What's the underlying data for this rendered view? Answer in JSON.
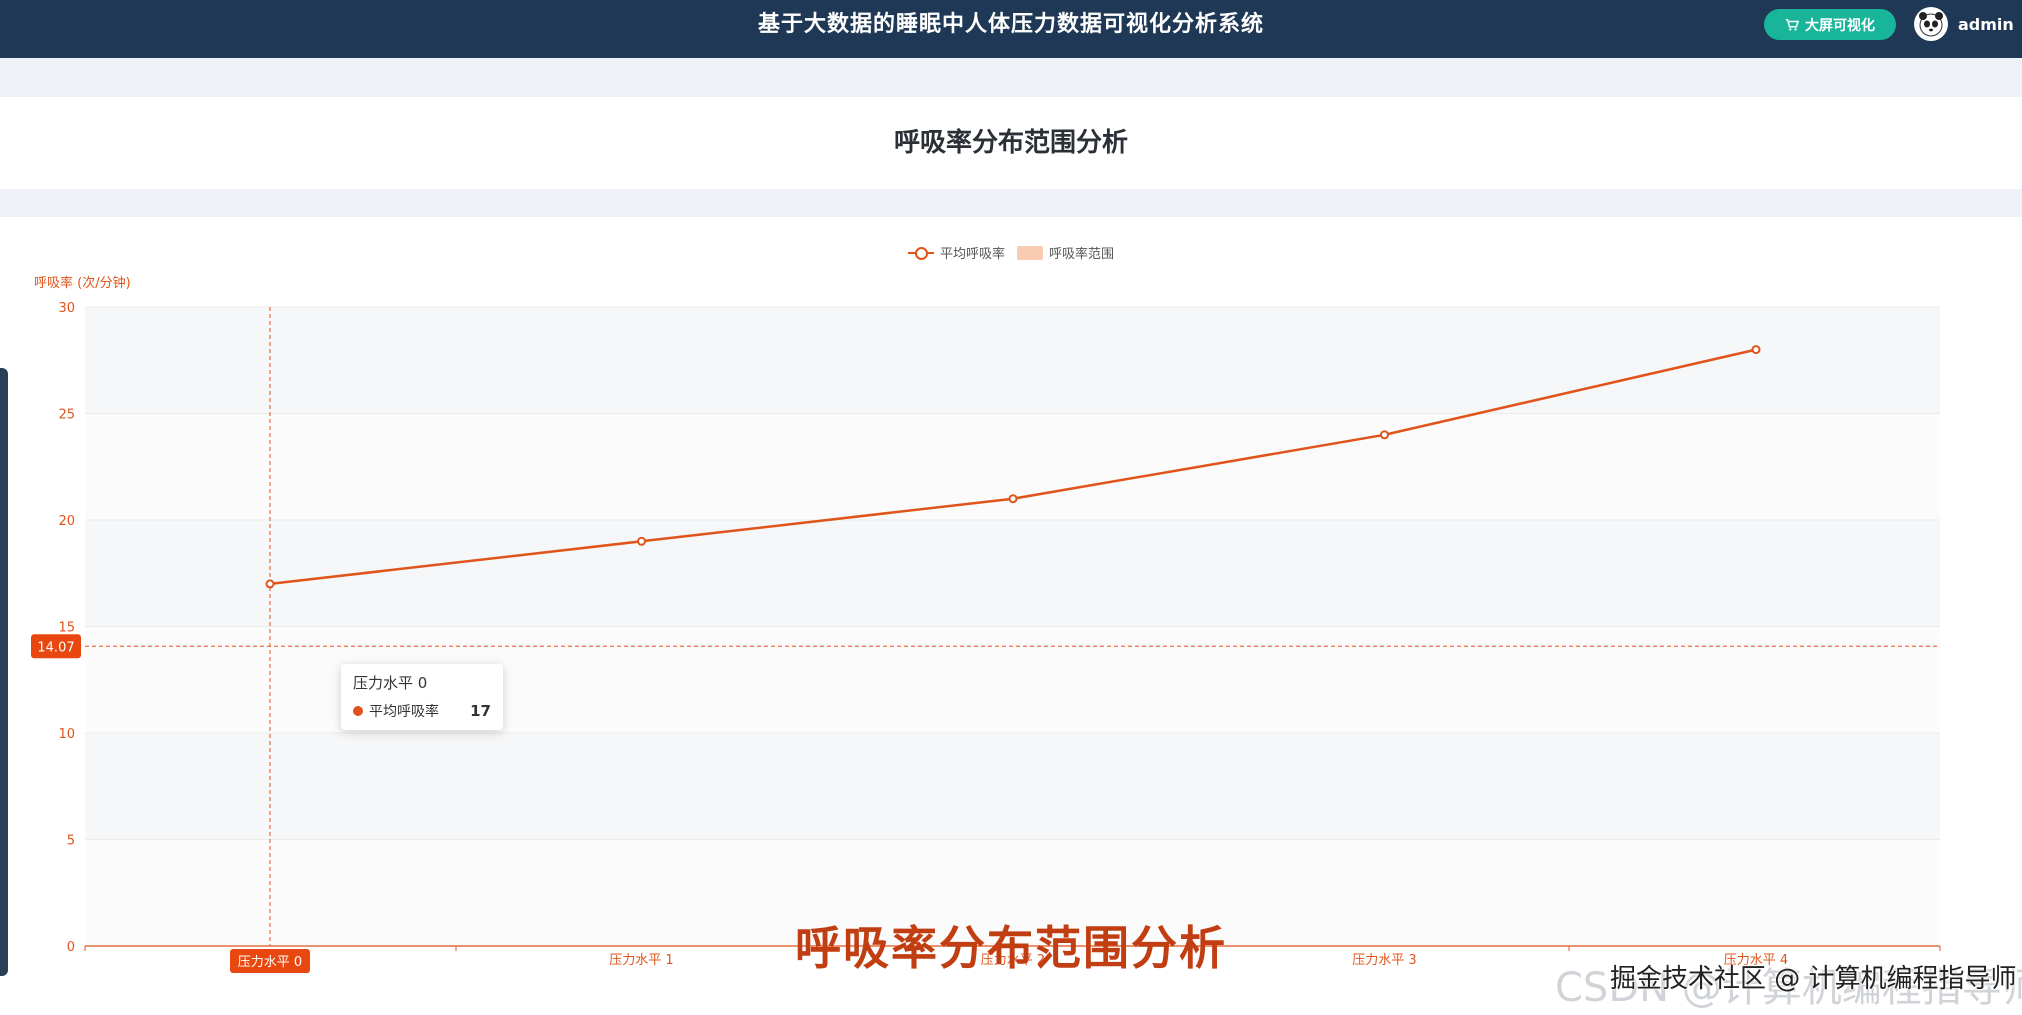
{
  "header": {
    "app_title": "基于大数据的睡眠中人体压力数据可视化分析系统",
    "screen_button_label": "大屏可视化",
    "screen_button_icon": "cart-icon",
    "username": "admin",
    "avatar_icon": "panda-avatar",
    "caret_icon": "chevron-down-icon",
    "bar_color": "#1f3855",
    "button_color": "#18b59a"
  },
  "page": {
    "title": "呼吸率分布范围分析",
    "overlay_caption": "呼吸率分布范围分析",
    "watermark_back": "CSDN @计算机编程指导师",
    "watermark_front": "掘金技术社区 @ 计算机编程指导师"
  },
  "legend": {
    "line_label": "平均呼吸率",
    "range_label": "呼吸率范围"
  },
  "tooltip": {
    "title": "压力水平 0",
    "series": "平均呼吸率",
    "value": "17"
  },
  "chart_data": {
    "type": "line",
    "categories": [
      "压力水平 0",
      "压力水平 1",
      "压力水平 2",
      "压力水平 3",
      "压力水平 4"
    ],
    "series": [
      {
        "name": "平均呼吸率",
        "values": [
          17,
          19,
          21,
          24,
          28
        ],
        "color": "#e0541b"
      }
    ],
    "range_series_name": "呼吸率范围",
    "ylabel": "呼吸率 (次/分钟)",
    "ylim": [
      0,
      30
    ],
    "yticks": [
      0,
      5,
      10,
      15,
      20,
      25,
      30
    ],
    "crosshair_y_label": "14.07",
    "crosshair_x_label": "压力水平 0",
    "axis_color": "#e0541b",
    "grid_band": true,
    "legend_position": "top-center"
  }
}
